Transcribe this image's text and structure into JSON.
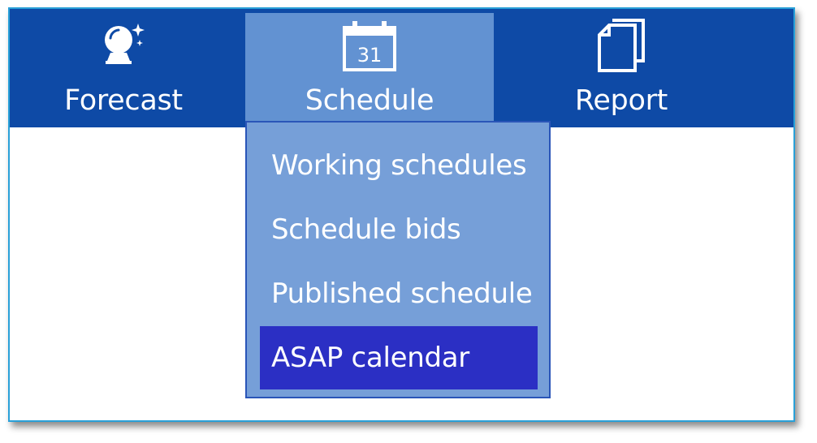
{
  "nav": {
    "tabs": [
      {
        "label": "Forecast",
        "icon": "crystal-ball-icon"
      },
      {
        "label": "Schedule",
        "icon": "calendar-icon",
        "calendar_day": "31",
        "active": true
      },
      {
        "label": "Report",
        "icon": "documents-icon"
      }
    ]
  },
  "dropdown": {
    "items": [
      {
        "label": "Working schedules"
      },
      {
        "label": "Schedule bids"
      },
      {
        "label": "Published schedule"
      },
      {
        "label": "ASAP calendar",
        "selected": true
      }
    ]
  },
  "colors": {
    "navbar": "#0e4aa6",
    "active_tab": "#6292d2",
    "dropdown_bg": "#769fd8",
    "selected_item": "#2b2fc4",
    "frame_border": "#29a0d8"
  }
}
